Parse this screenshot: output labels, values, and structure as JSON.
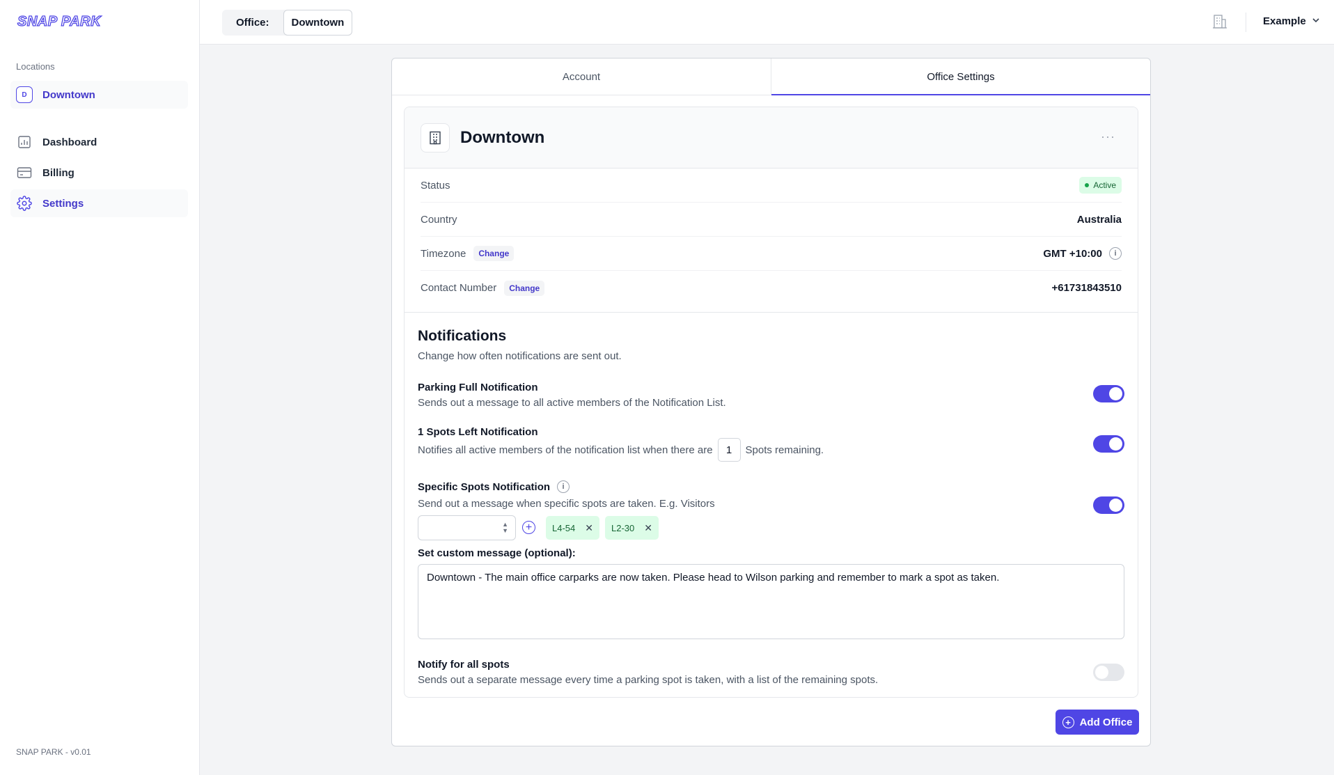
{
  "app": {
    "logo": "SNAP PARK",
    "version": "SNAP PARK - v0.01"
  },
  "sidebar": {
    "section_label": "Locations",
    "location": {
      "badge": "D",
      "label": "Downtown"
    },
    "items": [
      {
        "label": "Dashboard",
        "icon": "chart-icon"
      },
      {
        "label": "Billing",
        "icon": "credit-card-icon"
      },
      {
        "label": "Settings",
        "icon": "gear-icon"
      }
    ]
  },
  "header": {
    "office_label": "Office:",
    "office_value": "Downtown",
    "user_name": "Example"
  },
  "tabs": [
    {
      "label": "Account",
      "active": false
    },
    {
      "label": "Office Settings",
      "active": true
    }
  ],
  "office": {
    "name": "Downtown",
    "more": "···",
    "rows": {
      "status": {
        "label": "Status",
        "value": "Active"
      },
      "country": {
        "label": "Country",
        "value": "Australia"
      },
      "timezone": {
        "label": "Timezone",
        "action": "Change",
        "value": "GMT +10:00"
      },
      "contact": {
        "label": "Contact Number",
        "action": "Change",
        "value": "+61731843510"
      }
    }
  },
  "notifications": {
    "title": "Notifications",
    "subtitle": "Change how often notifications are sent out.",
    "parking_full": {
      "label": "Parking Full Notification",
      "desc": "Sends out a message to all active members of the Notification List.",
      "enabled": true
    },
    "spots_left": {
      "label": "1 Spots Left Notification",
      "desc_before": "Notifies all active members of the notification list when there are",
      "count": "1",
      "desc_after": "Spots remaining.",
      "enabled": true
    },
    "specific": {
      "label": "Specific Spots Notification",
      "desc": "Send out a message when specific spots are taken. E.g. Visitors",
      "enabled": true,
      "spots": [
        "L4-54",
        "L2-30"
      ]
    },
    "custom_message": {
      "label": "Set custom message (optional):",
      "value": "Downtown - The main office carparks are now taken. Please head to Wilson parking and remember to mark a spot as taken."
    },
    "all_spots": {
      "label": "Notify for all spots",
      "desc": "Sends out a separate message every time a parking spot is taken, with a list of the remaining spots.",
      "enabled": false
    }
  },
  "actions": {
    "add_office": "Add Office"
  },
  "colors": {
    "accent": "#4f46e5",
    "success_bg": "#dcfce7",
    "success_text": "#166534"
  }
}
